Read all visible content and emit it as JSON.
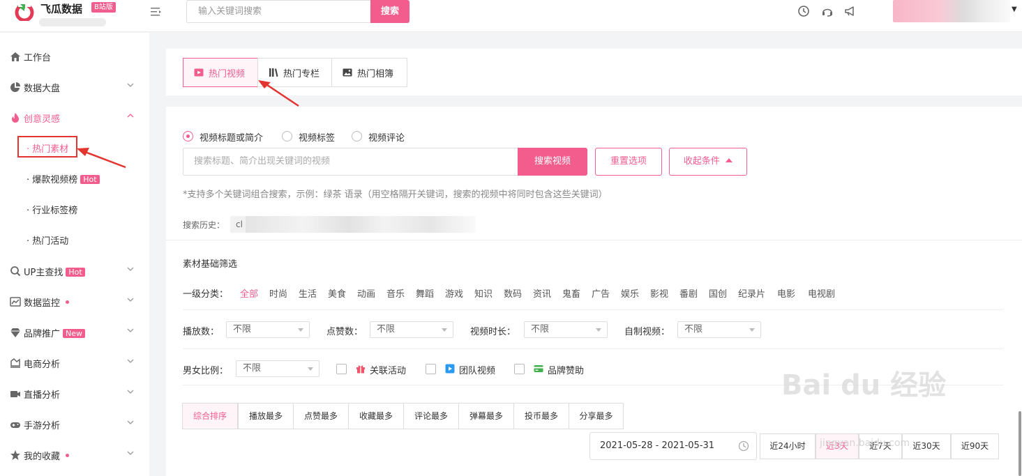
{
  "header": {
    "logo_text": "飞瓜数据",
    "logo_badge": "B站版",
    "search_placeholder": "输入关键词搜索",
    "search_button": "搜索",
    "icons": [
      "history-icon",
      "headset-icon",
      "megaphone-icon"
    ]
  },
  "sidebar": {
    "items": [
      {
        "label": "工作台",
        "icon": "home-icon"
      },
      {
        "label": "数据大盘",
        "icon": "pie-chart-icon"
      },
      {
        "label": "创意灵感",
        "icon": "flame-icon"
      },
      {
        "label": "UP主查找",
        "icon": "search-icon",
        "tag": "Hot"
      },
      {
        "label": "数据监控",
        "icon": "line-chart-icon"
      },
      {
        "label": "品牌推广",
        "icon": "diamond-icon",
        "tag": "New"
      },
      {
        "label": "电商分析",
        "icon": "trend-chart-icon"
      },
      {
        "label": "直播分析",
        "icon": "live-video-icon"
      },
      {
        "label": "手游分析",
        "icon": "gamepad-icon"
      },
      {
        "label": "我的收藏",
        "icon": "star-icon"
      }
    ],
    "sub_items": [
      {
        "label": "· 热门素材"
      },
      {
        "label": "· 爆款视频榜",
        "tag": "Hot"
      },
      {
        "label": "· 行业标签榜"
      },
      {
        "label": "· 热门活动"
      }
    ]
  },
  "tabs": [
    {
      "label": "热门视频",
      "icon": "video-play-icon"
    },
    {
      "label": "热门专栏",
      "icon": "books-icon"
    },
    {
      "label": "热门相簿",
      "icon": "image-icon"
    }
  ],
  "search_scope": {
    "options": [
      "视频标题或简介",
      "视频标签",
      "视频评论"
    ],
    "selected": "视频标题或简介"
  },
  "video_search": {
    "placeholder": "搜索标题、简介出现关键词的视频",
    "search_button": "搜索视频",
    "reset_button": "重置选项",
    "collapse_button": "收起条件"
  },
  "tip": "*支持多个关键词组合搜索，示例：绿茶 语录（用空格隔开关键词，搜索的视频中将同时包含这些关键词）",
  "history": {
    "label": "搜索历史：",
    "first_chip": "cl"
  },
  "filters": {
    "section_title": "素材基础筛选",
    "category_label": "一级分类：",
    "categories": [
      "全部",
      "时尚",
      "生活",
      "美食",
      "动画",
      "音乐",
      "舞蹈",
      "游戏",
      "知识",
      "数码",
      "资讯",
      "鬼畜",
      "广告",
      "娱乐",
      "影视",
      "番剧",
      "国创",
      "纪录片",
      "电影",
      "电视剧"
    ],
    "selected_category": "全部",
    "play_label": "播放数：",
    "like_label": "点赞数：",
    "duration_label": "视频时长：",
    "self_made_label": "自制视频：",
    "gender_label": "男女比例：",
    "unlimited": "不限",
    "checkboxes": [
      {
        "label": "关联活动",
        "icon": "gift-icon"
      },
      {
        "label": "团队视频",
        "icon": "team-video-icon"
      },
      {
        "label": "品牌赞助",
        "icon": "card-icon"
      }
    ]
  },
  "sort": {
    "options": [
      "综合排序",
      "播放最多",
      "点赞最多",
      "收藏最多",
      "评论最多",
      "弹幕最多",
      "投币最多",
      "分享最多"
    ],
    "selected": "综合排序"
  },
  "date_range": {
    "value": "2021-05-28 - 2021-05-31",
    "quick_ranges": [
      "近24小时",
      "近3天",
      "近7天",
      "近30天",
      "近90天"
    ],
    "selected": "近3天"
  },
  "watermark": {
    "text": "Bai du 经验",
    "url": "jingyan.baidu.com"
  },
  "colors": {
    "accent": "#f25d8e",
    "annotation": "#e3342f"
  }
}
